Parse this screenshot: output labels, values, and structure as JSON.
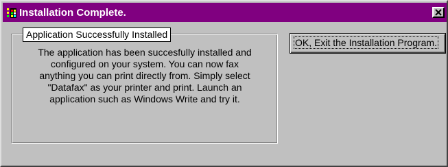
{
  "window": {
    "title": "Installation Complete.",
    "titlebar_color": "#800080",
    "close_icon": "close-icon",
    "app_icon": "app-icon"
  },
  "group": {
    "label": "Application Successfully Installed",
    "message_lines": [
      "The application has been succesfully installed and",
      "configured on your system.  You can now fax",
      "anything you can print directly from.  Simply select",
      "\"Datafax\" as your printer and print.  Launch an",
      "application such as Windows Write and try it."
    ]
  },
  "buttons": {
    "ok_label": "OK, Exit the Installation Program."
  }
}
